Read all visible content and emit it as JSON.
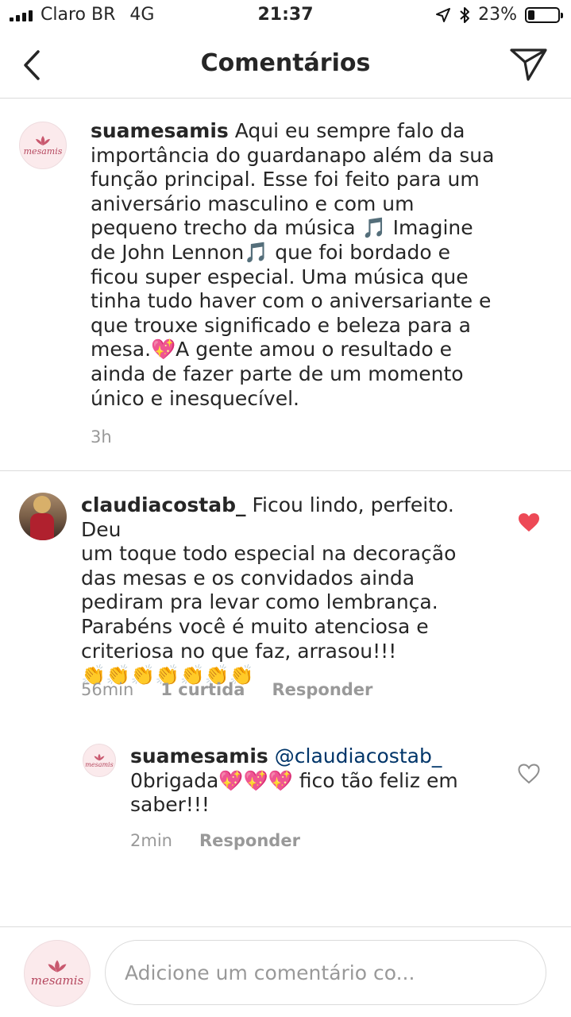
{
  "status_bar": {
    "carrier": "Claro BR",
    "network": "4G",
    "time": "21:37",
    "battery_percent": "23%",
    "battery_level": 0.23,
    "icons": [
      "signal-bars-icon",
      "location-arrow-icon",
      "bluetooth-icon",
      "battery-icon"
    ]
  },
  "nav": {
    "title": "Comentários",
    "back_icon": "chevron-left-icon",
    "send_icon": "paper-plane-icon"
  },
  "comments": [
    {
      "username": "suamesamis",
      "avatar_text": "mesamis",
      "lines": [
        "Aqui eu sempre falo da",
        "importância do guardanapo além da sua",
        "função principal. Esse foi feito para um",
        "aniversário masculino e com um",
        "pequeno trecho da música 🎵 Imagine",
        "de John Lennon🎵 que foi bordado e",
        "ficou super especial. Uma música que",
        "tinha tudo haver com o aniversariante e",
        "que trouxe significado e beleza para a",
        "mesa.💖A gente amou o resultado e",
        "ainda de fazer parte de um momento",
        "único e inesquecível."
      ],
      "time": "3h"
    },
    {
      "username": "claudiacostab_",
      "lines": [
        "Ficou lindo, perfeito. Deu",
        "um toque todo especial na decoração",
        "das mesas e os convidados ainda",
        "pediram pra levar como lembrança.",
        "Parabéns você é muito atenciosa e",
        "criteriosa no que faz, arrasou!!!",
        "👏👏👏👏👏👏👏"
      ],
      "time": "56min",
      "likes": "1 curtida",
      "reply_label": "Responder",
      "liked": true,
      "like_icon": "heart-filled-icon",
      "like_color": "#ed4956"
    },
    {
      "username": "suamesamis",
      "avatar_text": "mesamis",
      "mention": "@claudiacostab_",
      "lines": [
        "0brigada💖💖💖 fico tão feliz em",
        "saber!!!"
      ],
      "time": "2min",
      "reply_label": "Responder",
      "liked": false,
      "like_icon": "heart-outline-icon"
    }
  ],
  "composer": {
    "avatar_text": "mesamis",
    "placeholder": "Adicione um comentário co..."
  }
}
